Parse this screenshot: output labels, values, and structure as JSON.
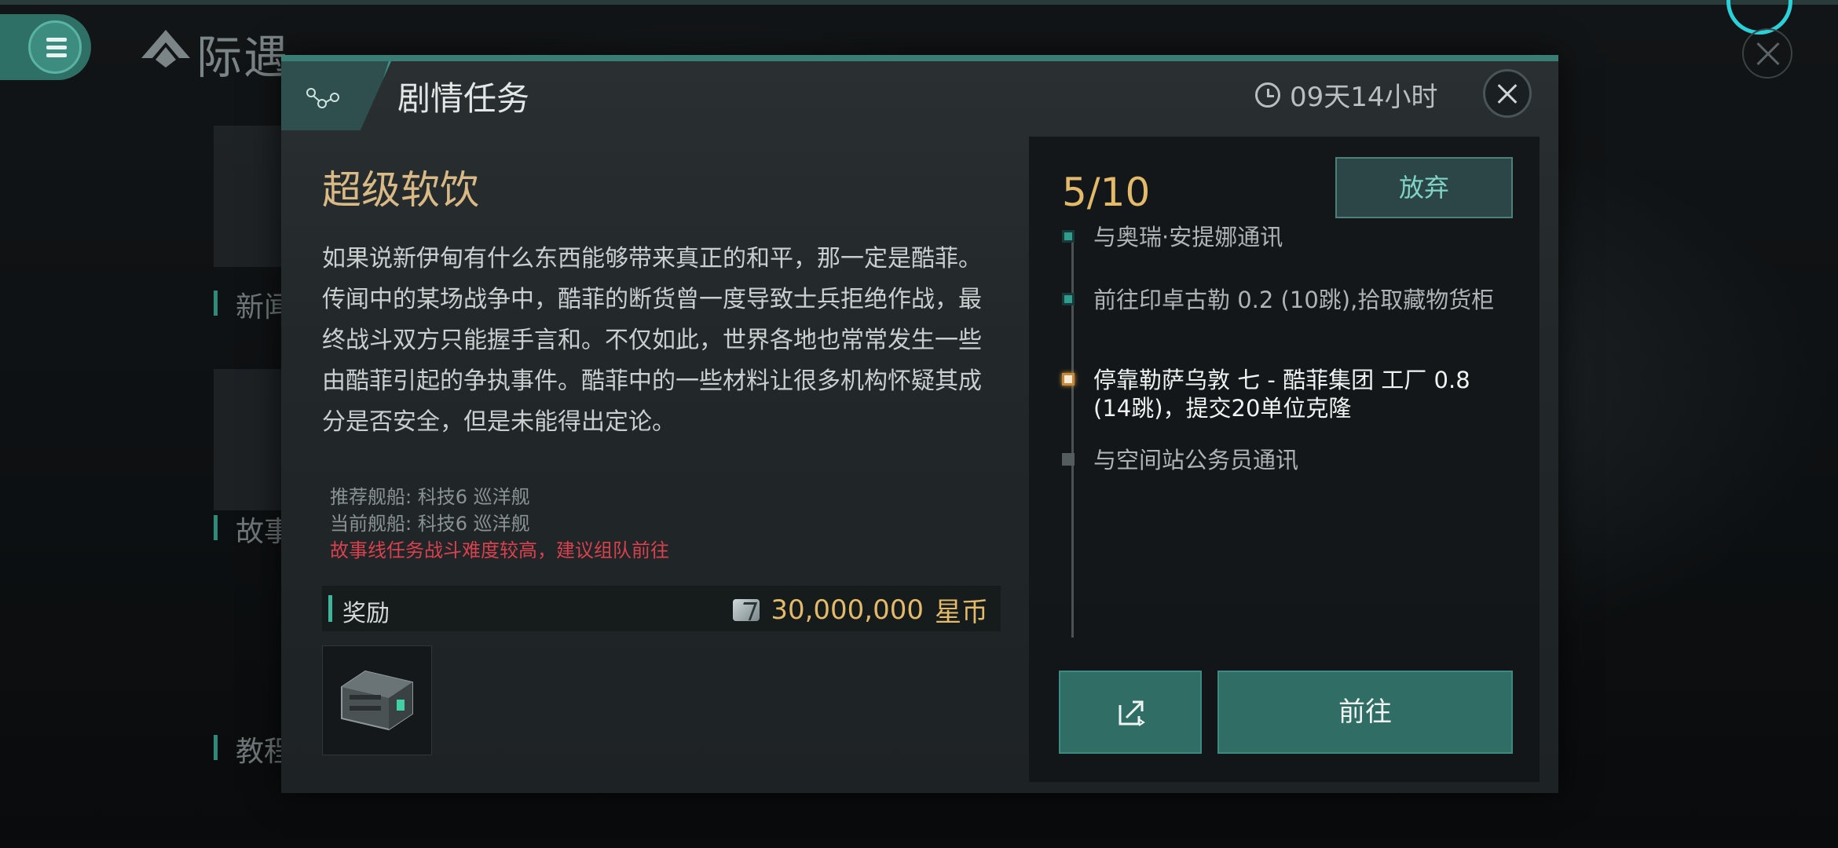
{
  "app": {
    "title": "际遇"
  },
  "background": {
    "side_labels": [
      "新闻",
      "故事",
      "教程"
    ]
  },
  "modal": {
    "header_title": "剧情任务",
    "timer": "09天14小时",
    "quest_name": "超级软饮",
    "description": "如果说新伊甸有什么东西能够带来真正的和平，那一定是酷菲。传闻中的某场战争中，酷菲的断货曾一度导致士兵拒绝作战，最终战斗双方只能握手言和。不仅如此，世界各地也常常发生一些由酷菲引起的争执事件。酷菲中的一些材料让很多机构怀疑其成分是否安全，但是未能得出定论。",
    "recommended_ship": "推荐舰船: 科技6 巡洋舰",
    "current_ship": "当前舰船: 科技6 巡洋舰",
    "warning": "故事线任务战斗难度较高，建议组队前往",
    "reward": {
      "label": "奖励",
      "amount": "30,000,000",
      "currency": "星币"
    },
    "progress": "5/10",
    "abandon_label": "放弃",
    "go_label": "前往",
    "steps": [
      {
        "text": "与奥瑞·安提娜通讯",
        "status": "done"
      },
      {
        "text": "前往印卓古勒 0.2 (10跳),拾取藏物货柜",
        "status": "done"
      },
      {
        "text": "停靠勒萨乌敦 七 - 酷菲集团 工厂 0.8 (14跳)，提交20单位克隆",
        "status": "current"
      },
      {
        "text": "与空间站公务员通讯",
        "status": "todo"
      }
    ]
  },
  "colors": {
    "accent_teal": "#2f6d65",
    "gold": "#e3b96a",
    "warning_red": "#d8414d"
  }
}
